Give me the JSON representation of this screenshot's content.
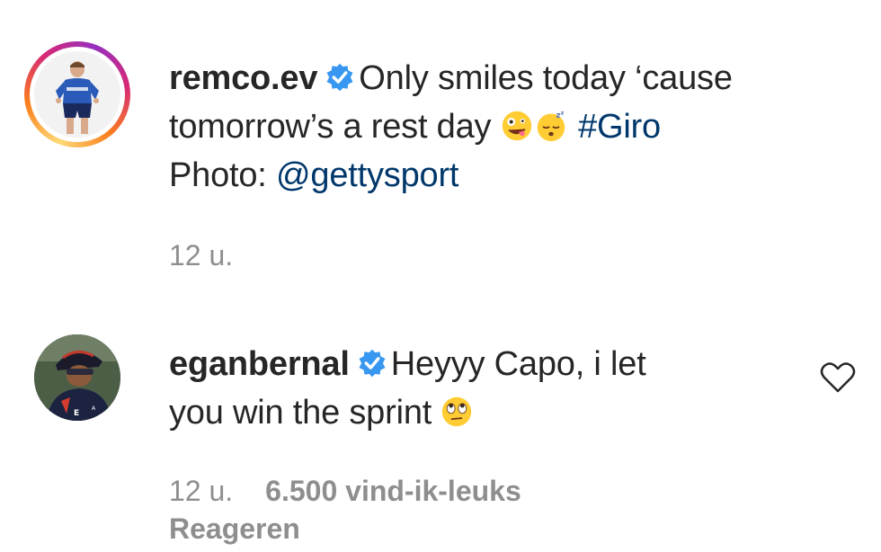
{
  "post": {
    "username": "remco.ev",
    "caption_line1": "Only smiles today ‘cause",
    "caption_line2": "tomorrow’s a rest day",
    "hashtag": "#Giro",
    "photo_prefix": "Photo:",
    "photo_mention": "@gettysport",
    "time": "12 u."
  },
  "comment": {
    "username": "eganbernal",
    "text_line1": "Heyyy Capo, i let",
    "text_line2": "you win the sprint",
    "time": "12 u.",
    "likes": "6.500 vind-ik-leuks",
    "reply_label": "Reageren"
  },
  "icons": {
    "verified": "verified-badge-icon",
    "like": "heart-outline-icon",
    "emoji_1": "zany-face-emoji",
    "emoji_2": "sleeping-face-emoji",
    "emoji_3": "eye-roll-emoji"
  },
  "colors": {
    "text": "#262626",
    "muted": "#8e8e8e",
    "link": "#00376b",
    "verified": "#3897f0"
  }
}
